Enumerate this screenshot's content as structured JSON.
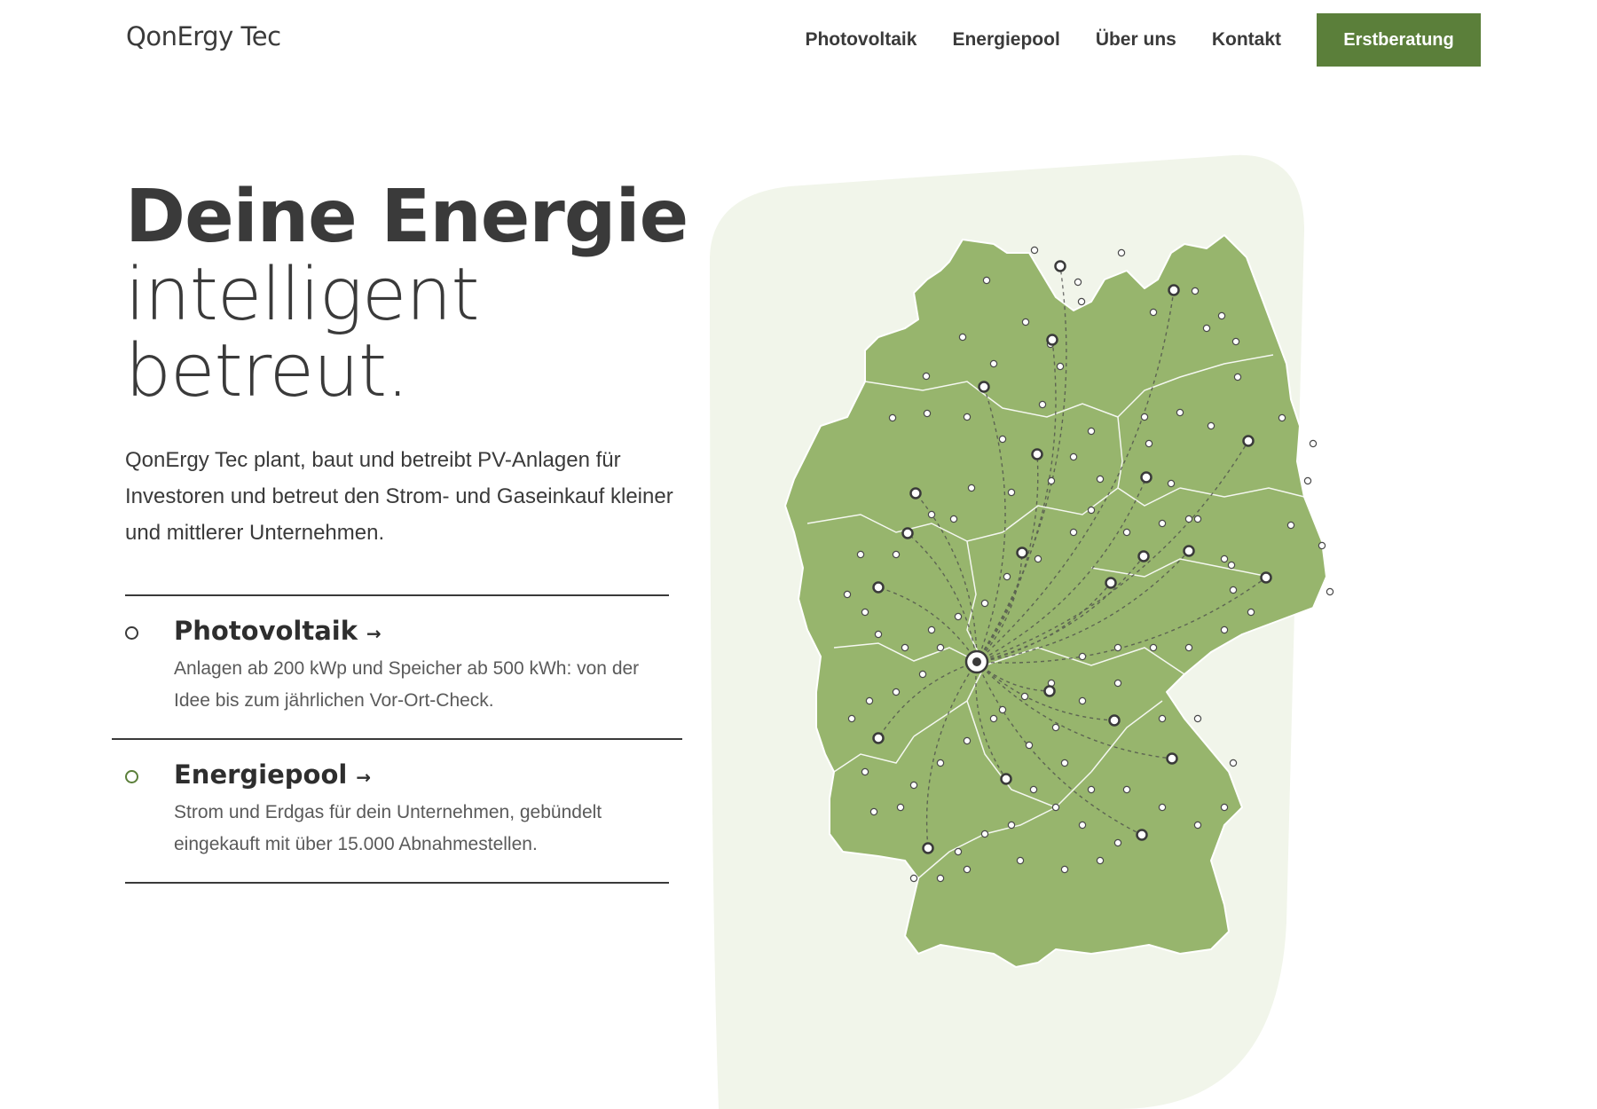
{
  "header": {
    "logo": "QonErgy Tec",
    "nav": [
      "Photovoltaik",
      "Energiepool",
      "Über uns",
      "Kontakt"
    ],
    "cta": "Erstberatung"
  },
  "hero": {
    "line1": "Deine Energie",
    "line2": "intelligent",
    "line3": "betreut.",
    "intro": "QonErgy Tec plant, baut und betreibt PV-Anlagen für Investoren und betreut den Strom- und Gaseinkauf kleiner und mittlerer Unternehmen."
  },
  "services": [
    {
      "title": "Photovoltaik",
      "arrow": "→",
      "desc": "Anlagen ab 200 kWp und Speicher ab 500 kWh: von der Idee bis zum jährlichen Vor-Ort-Check."
    },
    {
      "title": "Energiepool",
      "arrow": "→",
      "desc": "Strom und Erdgas für dein Unternehmen, gebündelt eingekauft mit über 15.000 Abnahmestellen."
    }
  ],
  "colors": {
    "accent": "#5b7f3a",
    "map_fill": "#97b56d",
    "map_bg": "#f1f5ea",
    "text": "#3a3a3a"
  },
  "map": {
    "icon": "germany-map-icon"
  }
}
